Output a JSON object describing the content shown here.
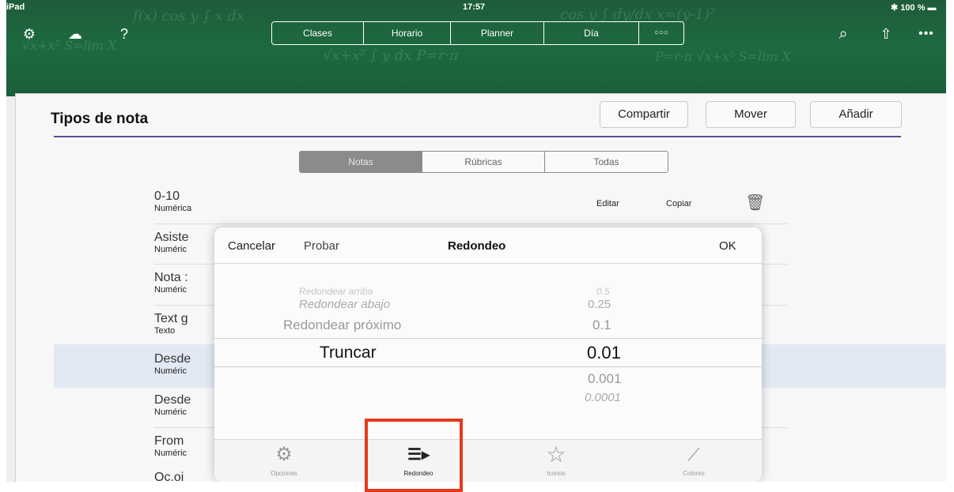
{
  "status_bar": {
    "device": "iPad",
    "time": "17:57",
    "battery": "100 %"
  },
  "toolbar": {
    "left_icons": [
      "gear-icon",
      "cloud-upload-icon",
      "help-icon"
    ],
    "segments": [
      "Clases",
      "Horario",
      "Planner",
      "Día",
      "○○○"
    ],
    "right_icons": [
      "search-icon",
      "share-icon",
      "more-icon"
    ]
  },
  "sheet": {
    "title": "Tipos de nota",
    "buttons": {
      "share": "Compartir",
      "move": "Mover",
      "add": "Añadir"
    },
    "filter_tabs": [
      "Notas",
      "Rúbricas",
      "Todas"
    ],
    "active_filter": "Notas"
  },
  "rows": [
    {
      "name": "0-10",
      "sub": "Numérica"
    },
    {
      "name": "Asiste",
      "sub": "Numéric"
    },
    {
      "name": "Nota :",
      "sub": "Numéric"
    },
    {
      "name": "Text g",
      "sub": "Texto"
    },
    {
      "name": "Desde",
      "sub": "Numéric"
    },
    {
      "name": "Desde",
      "sub": "Numéric"
    },
    {
      "name": "From",
      "sub": "Numéric"
    },
    {
      "name": "Oc.oi",
      "sub": ""
    }
  ],
  "row_actions": {
    "edit": "Editar",
    "copy": "Copiar"
  },
  "popup": {
    "cancel": "Cancelar",
    "test": "Probar",
    "title": "Redondeo",
    "ok": "OK",
    "picker_left": [
      "Redondear arriba",
      "Redondear abajo",
      "Redondear próximo",
      "Truncar"
    ],
    "picker_left_selected": "Truncar",
    "picker_right": [
      "0.5",
      "0.25",
      "0.1",
      "0.01",
      "0.001",
      "0.0001"
    ],
    "picker_right_selected": "0.01",
    "tabs": [
      {
        "label": "Opciones",
        "icon": "gear-icon"
      },
      {
        "label": "Redondeo",
        "icon": "rounding-icon"
      },
      {
        "label": "Iconos",
        "icon": "star-icon"
      },
      {
        "label": "Colores",
        "icon": "brush-icon"
      }
    ],
    "active_tab": "Redondeo"
  },
  "colors": {
    "header_green": "#1d6a3f",
    "accent_line": "#5a4e97",
    "highlight": "#e3e9f4",
    "callout_red": "#e8381c"
  }
}
